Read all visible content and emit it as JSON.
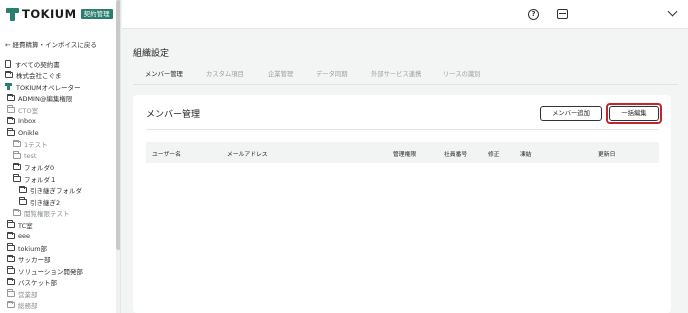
{
  "brand": {
    "name": "TOKIUM",
    "badge": "契約管理"
  },
  "sidebar": {
    "back_link": "← 経費精算・インボイスに戻る",
    "items": [
      {
        "label": "すべての契約書",
        "icon": "document-icon",
        "level": 0,
        "muted": false
      },
      {
        "label": "株式会社こぐま",
        "icon": "folder-icon",
        "level": 0,
        "muted": false
      },
      {
        "label": "TOKIUMオペレーター",
        "icon": "tokium-icon",
        "level": 0,
        "muted": false
      },
      {
        "label": "ADMIN@編集権限",
        "icon": "folder-icon",
        "level": 1,
        "muted": false
      },
      {
        "label": "CTO室",
        "icon": "folder-icon",
        "level": 1,
        "muted": true
      },
      {
        "label": "Inbox",
        "icon": "folder-icon",
        "level": 1,
        "muted": false
      },
      {
        "label": "Onikle",
        "icon": "folder-icon",
        "level": 1,
        "muted": false
      },
      {
        "label": "1テスト",
        "icon": "folder-icon",
        "level": 2,
        "muted": true
      },
      {
        "label": "test",
        "icon": "folder-icon",
        "level": 2,
        "muted": true
      },
      {
        "label": "フォルダ0",
        "icon": "folder-icon",
        "level": 2,
        "muted": false
      },
      {
        "label": "フォルダ１",
        "icon": "folder-icon",
        "level": 2,
        "muted": false
      },
      {
        "label": "引き継ぎフォルダ",
        "icon": "folder-icon",
        "level": 3,
        "muted": false
      },
      {
        "label": "引き継ぎ2",
        "icon": "folder-icon",
        "level": 3,
        "muted": false
      },
      {
        "label": "閲覧権限テスト",
        "icon": "folder-icon",
        "level": 2,
        "muted": true
      },
      {
        "label": "TC室",
        "icon": "folder-icon",
        "level": 1,
        "muted": false
      },
      {
        "label": "eee",
        "icon": "folder-icon",
        "level": 1,
        "muted": false
      },
      {
        "label": "tokium部",
        "icon": "folder-icon",
        "level": 1,
        "muted": false
      },
      {
        "label": "サッカー部",
        "icon": "folder-icon",
        "level": 1,
        "muted": false
      },
      {
        "label": "ソリューション開発部",
        "icon": "folder-icon",
        "level": 1,
        "muted": false
      },
      {
        "label": "バスケット部",
        "icon": "folder-icon",
        "level": 1,
        "muted": false
      },
      {
        "label": "営業部",
        "icon": "folder-icon",
        "level": 1,
        "muted": true
      },
      {
        "label": "総務部",
        "icon": "folder-icon",
        "level": 1,
        "muted": true
      }
    ]
  },
  "topbar": {
    "icons": [
      "help-icon",
      "inbox-icon",
      "chevron-down-icon"
    ]
  },
  "page": {
    "title": "組織設定",
    "tabs": [
      {
        "label": "メンバー管理",
        "active": true
      },
      {
        "label": "カスタム項目",
        "active": false
      },
      {
        "label": "企業管理",
        "active": false
      },
      {
        "label": "データ同期",
        "active": false
      },
      {
        "label": "外部サービス連携",
        "active": false
      },
      {
        "label": "リースの識別",
        "active": false
      }
    ]
  },
  "members": {
    "title": "メンバー管理",
    "add_button": "メンバー追加",
    "bulk_edit_button": "一括編集",
    "columns": [
      "ユーザー名",
      "メールアドレス",
      "管理権限",
      "社員番号",
      "修正",
      "凍結",
      "更新日"
    ]
  },
  "colors": {
    "accent": "#2a7d6f",
    "highlight": "#c0262d"
  }
}
